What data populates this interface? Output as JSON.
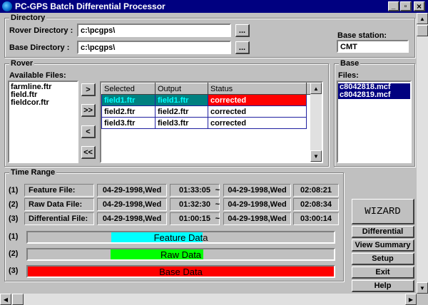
{
  "window": {
    "title": "PC-GPS Batch Differential Processor",
    "min": "_",
    "max": "▫",
    "close": "×"
  },
  "directory": {
    "group_label": "Directory",
    "rover_label": "Rover Directory :",
    "rover_value": "c:\\pcgps\\",
    "base_label": "Base Directory :",
    "base_value": "c:\\pcgps\\",
    "browse": "...",
    "base_station_label": "Base station:",
    "base_station_value": "CMT"
  },
  "rover": {
    "group_label": "Rover",
    "available_label": "Available Files:",
    "available_files": [
      "farmline.ftr",
      "field.ftr",
      "fieldcor.ftr"
    ],
    "move_buttons": [
      ">",
      ">>",
      "<",
      "<<"
    ],
    "table": {
      "headers": [
        "Selected",
        "Output",
        "Status"
      ],
      "rows": [
        {
          "selected": "field1.ftr",
          "output": "field1.ftr",
          "status": "corrected"
        },
        {
          "selected": "field2.ftr",
          "output": "field2.ftr",
          "status": "corrected"
        },
        {
          "selected": "field3.ftr",
          "output": "field3.ftr",
          "status": "corrected"
        }
      ]
    }
  },
  "base": {
    "group_label": "Base",
    "files_label": "Files:",
    "files": [
      "c8042818.mcf",
      "c8042819.mcf"
    ]
  },
  "time_range": {
    "group_label": "Time Range",
    "rows": [
      {
        "num": "(1)",
        "label": "Feature  File:",
        "start_date": "04-29-1998,Wed",
        "start_time": "01:33:05",
        "tilde": "~",
        "end_date": "04-29-1998,Wed",
        "end_time": "02:08:21"
      },
      {
        "num": "(2)",
        "label": "Raw  Data File:",
        "start_date": "04-29-1998,Wed",
        "start_time": "01:32:30",
        "tilde": "~",
        "end_date": "04-29-1998,Wed",
        "end_time": "02:08:34"
      },
      {
        "num": "(3)",
        "label": "Differential File:",
        "start_date": "04-29-1998,Wed",
        "start_time": "01:00:15",
        "tilde": "~",
        "end_date": "04-29-1998,Wed",
        "end_time": "03:00:14"
      }
    ],
    "bars": [
      {
        "num": "(1)",
        "label": "Feature Data",
        "color": "#00ffff",
        "start": 0.273,
        "end": 0.572
      },
      {
        "num": "(2)",
        "label": "Raw Data",
        "color": "#00ff00",
        "start": 0.27,
        "end": 0.574
      },
      {
        "num": "(3)",
        "label": "Base Data",
        "color": "#ff0000",
        "start": 0.0,
        "end": 1.0
      }
    ]
  },
  "actions": {
    "wizard": "WIZARD",
    "differential": "Differential",
    "view_summary": "View Summary",
    "setup": "Setup",
    "exit": "Exit",
    "help": "Help"
  },
  "colors": {
    "title_bar": "#000080",
    "selection": "#000080",
    "status_red": "#ff0000",
    "teal_row": "#008080"
  }
}
